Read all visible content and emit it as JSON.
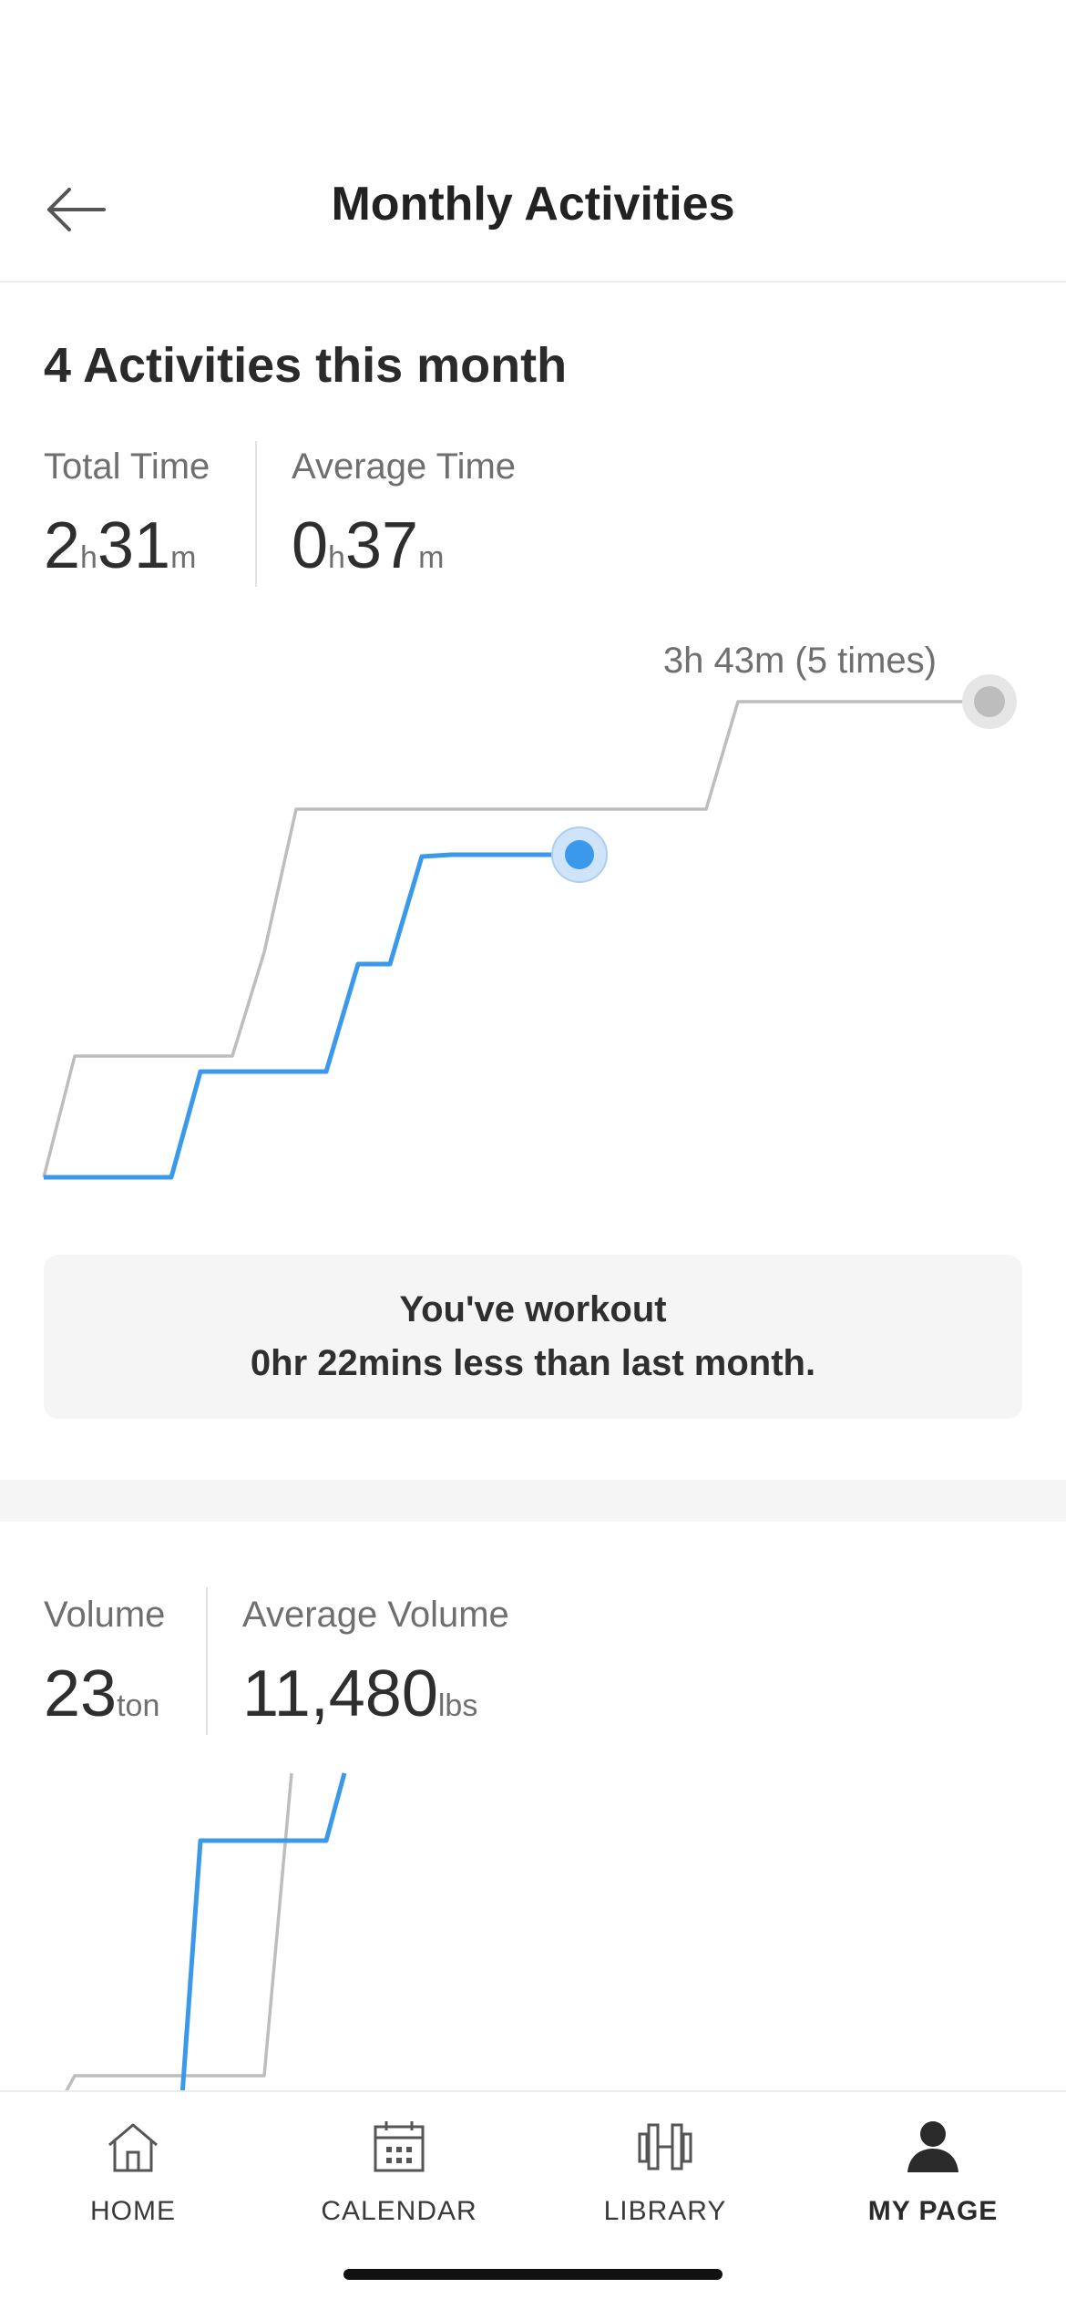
{
  "header": {
    "title": "Monthly Activities",
    "back_icon": "arrow-left-icon"
  },
  "summary": {
    "title": "4 Activities this month",
    "total_time": {
      "label": "Total Time",
      "hours": "2",
      "h_unit": "h",
      "minutes": "31",
      "m_unit": "m"
    },
    "average_time": {
      "label": "Average Time",
      "hours": "0",
      "h_unit": "h",
      "minutes": "37",
      "m_unit": "m"
    }
  },
  "time_chart": {
    "annotation": "3h 43m (5 times)",
    "colors": {
      "current": "#3A99EA",
      "previous": "#BDBDBD"
    },
    "current_level": 0.62,
    "previous_level": 1.0
  },
  "message": {
    "line1": "You've workout",
    "line2": "0hr 22mins less than last month."
  },
  "volume": {
    "label": "Volume",
    "value": "23",
    "unit": "ton",
    "avg_label": "Average Volume",
    "avg_value": "11,480",
    "avg_unit": "lbs"
  },
  "tabbar": {
    "tabs": [
      {
        "label": "HOME",
        "icon": "home-icon"
      },
      {
        "label": "CALENDAR",
        "icon": "calendar-icon"
      },
      {
        "label": "LIBRARY",
        "icon": "dumbbell-icon"
      },
      {
        "label": "MY PAGE",
        "icon": "person-icon",
        "active": true
      }
    ]
  }
}
